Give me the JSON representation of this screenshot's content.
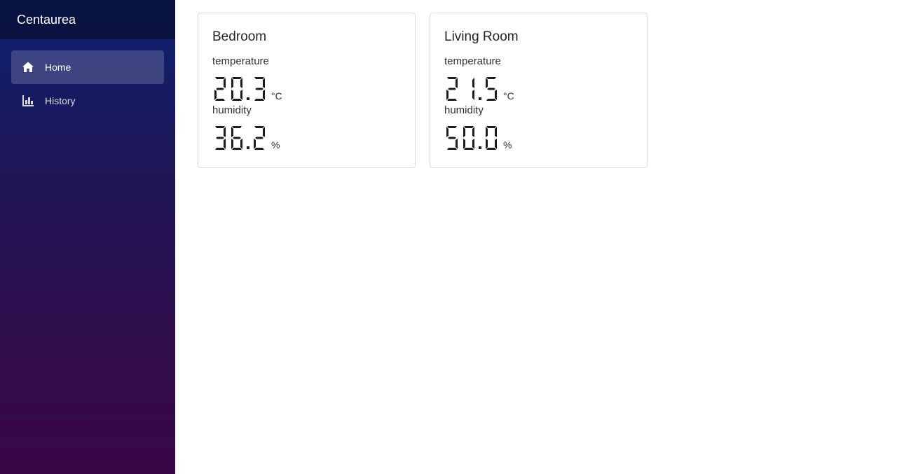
{
  "app": {
    "title": "Centaurea"
  },
  "sidebar": {
    "items": [
      {
        "label": "Home",
        "icon": "home-icon",
        "active": true
      },
      {
        "label": "History",
        "icon": "bar-chart-icon",
        "active": false
      }
    ]
  },
  "rooms": [
    {
      "name": "Bedroom",
      "temperature": {
        "label": "temperature",
        "value": "20.3",
        "unit": "°C"
      },
      "humidity": {
        "label": "humidity",
        "value": "36.2",
        "unit": "%"
      }
    },
    {
      "name": "Living Room",
      "temperature": {
        "label": "temperature",
        "value": "21.5",
        "unit": "°C"
      },
      "humidity": {
        "label": "humidity",
        "value": "50.0",
        "unit": "%"
      }
    }
  ],
  "colors": {
    "sidebar_top": "#0d2170",
    "sidebar_bottom": "#3a0646",
    "digit": "#1d1d1d"
  }
}
